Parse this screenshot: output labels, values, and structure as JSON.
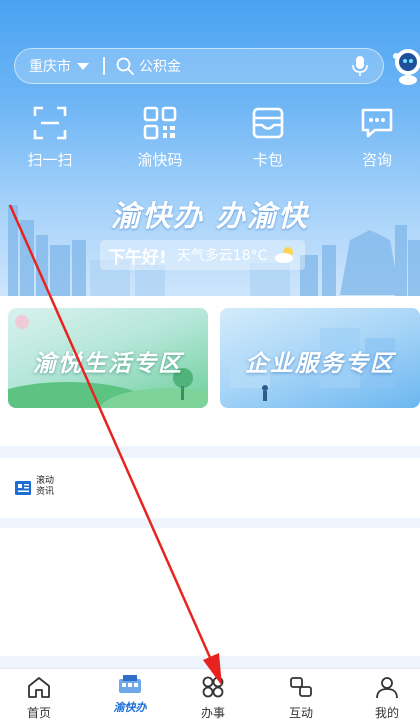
{
  "header": {
    "city": "重庆市",
    "search_placeholder": "公积金"
  },
  "quick_actions": [
    {
      "label": "扫一扫",
      "icon": "scan-icon"
    },
    {
      "label": "渝快码",
      "icon": "qrcode-icon"
    },
    {
      "label": "卡包",
      "icon": "wallet-icon"
    },
    {
      "label": "咨询",
      "icon": "chat-icon"
    }
  ],
  "banner": {
    "slogan": "渝快办 办渝快",
    "greeting": "下午好!",
    "weather": "天气多云18°C"
  },
  "zones": [
    {
      "label": "渝悦生活专区"
    },
    {
      "label": "企业服务专区"
    }
  ],
  "news": {
    "label": "滚动资讯"
  },
  "bottom_nav": [
    {
      "label": "首页",
      "icon": "home-icon"
    },
    {
      "label": "",
      "icon": "yukuaiban-logo-icon",
      "logo_text": "渝快办"
    },
    {
      "label": "办事",
      "icon": "grid-icon"
    },
    {
      "label": "互动",
      "icon": "interact-icon"
    },
    {
      "label": "我的",
      "icon": "user-icon"
    }
  ],
  "colors": {
    "header_top": "#4aa3f2",
    "accent": "#1d6fd6",
    "annotation_arrow": "#e8231f"
  }
}
